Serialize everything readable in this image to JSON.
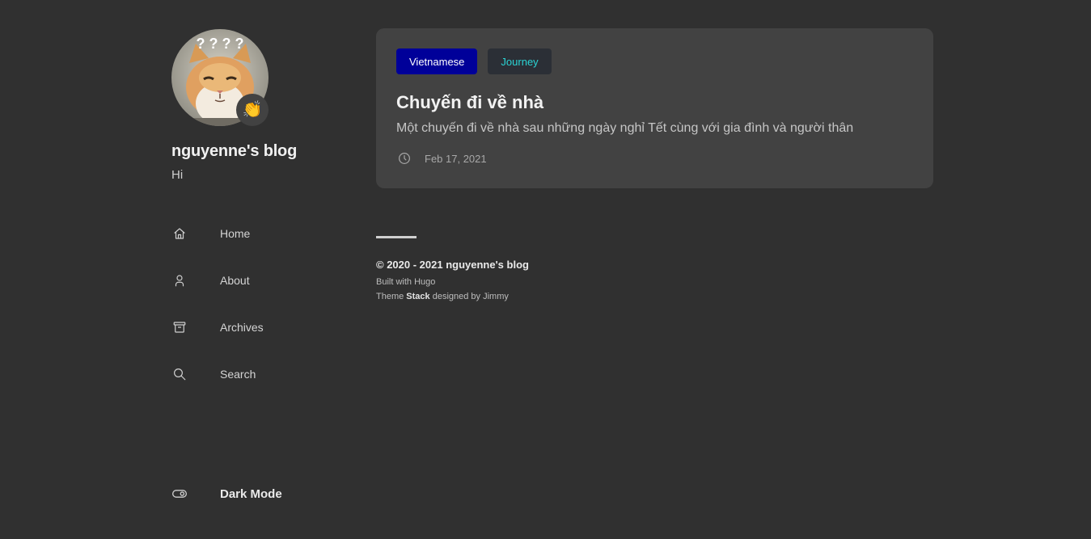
{
  "sidebar": {
    "avatar_emoji": "👏",
    "avatar_text": "? ? ? ?",
    "site_title": "nguyenne's blog",
    "site_description": "Hi",
    "menu": [
      {
        "label": "Home",
        "icon": "home-icon"
      },
      {
        "label": "About",
        "icon": "user-icon"
      },
      {
        "label": "Archives",
        "icon": "archive-icon"
      },
      {
        "label": "Search",
        "icon": "search-icon"
      }
    ],
    "dark_mode_label": "Dark Mode"
  },
  "article": {
    "tags": [
      {
        "label": "Vietnamese",
        "color": "#000099",
        "text_color": "#ffffff"
      },
      {
        "label": "Journey",
        "color": "#2b2f36",
        "text_color": "#2ad4d4"
      }
    ],
    "title": "Chuyến đi về nhà",
    "subtitle": "Một chuyến đi về nhà sau những ngày nghỉ Tết cùng với gia đình và người thân",
    "date": "Feb 17, 2021"
  },
  "footer": {
    "copyright": "© 2020 - 2021 nguyenne's blog",
    "built_prefix": "Built with ",
    "built_link": "Hugo",
    "theme_prefix": "Theme ",
    "theme_name": "Stack",
    "theme_designed": " designed by ",
    "theme_author": "Jimmy"
  },
  "colors": {
    "background": "#303030",
    "card": "#424242",
    "tag_vietnamese": "#000099",
    "tag_journey": "#2b2f36"
  }
}
